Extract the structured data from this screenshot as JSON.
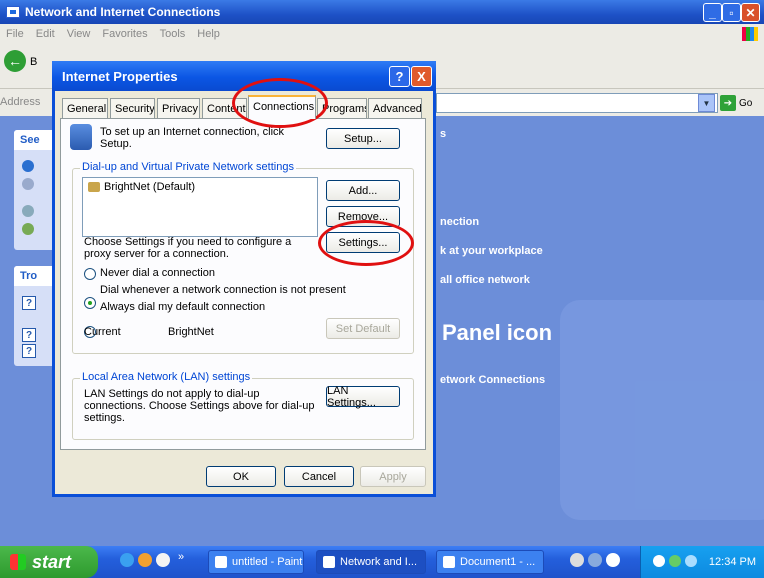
{
  "explorer": {
    "title": "Network and Internet Connections",
    "menu": [
      "File",
      "Edit",
      "View",
      "Favorites",
      "Tools",
      "Help"
    ],
    "back_label": "B",
    "address_label": "Address",
    "go_label": "Go",
    "left_panel": {
      "see_heading": "See",
      "tro_heading": "Tro"
    },
    "right_content": {
      "s": "s",
      "item1": "nection",
      "item2": "k at your workplace",
      "item3": "all office network",
      "panel_icon": "Panel icon",
      "item4": "etwork Connections"
    }
  },
  "dialog": {
    "title": "Internet Properties",
    "help_btn": "?",
    "close_btn": "X",
    "tabs": [
      "General",
      "Security",
      "Privacy",
      "Content",
      "Connections",
      "Programs",
      "Advanced"
    ],
    "active_tab": "Connections",
    "setup_text": "To set up an Internet connection, click Setup.",
    "setup_btn": "Setup...",
    "dialup_group_label": "Dial-up and Virtual Private Network settings",
    "connections_list": [
      "BrightNet (Default)"
    ],
    "add_btn": "Add...",
    "remove_btn": "Remove...",
    "settings_text": "Choose Settings if you need to configure a proxy server for a connection.",
    "settings_btn": "Settings...",
    "radio_never": "Never dial a connection",
    "radio_whenever": "Dial whenever a network connection is not present",
    "radio_always": "Always dial my default connection",
    "selected_radio": "Dial whenever a network connection is not present",
    "current_label": "Current",
    "current_value": "BrightNet",
    "set_default_btn": "Set Default",
    "lan_group_label": "Local Area Network (LAN) settings",
    "lan_text": "LAN Settings do not apply to dial-up connections. Choose Settings above for dial-up settings.",
    "lan_btn": "LAN Settings...",
    "ok_btn": "OK",
    "cancel_btn": "Cancel",
    "apply_btn": "Apply"
  },
  "taskbar": {
    "start_label": "start",
    "chevron": "»",
    "tasks": [
      "untitled - Paint",
      "Network and I...",
      "Document1 - ..."
    ],
    "clock": "12:34 PM"
  },
  "colors": {
    "xp_blue": "#0a4fd8",
    "highlight_red": "#e01010",
    "explorer_bg": "#6c8ed9"
  }
}
